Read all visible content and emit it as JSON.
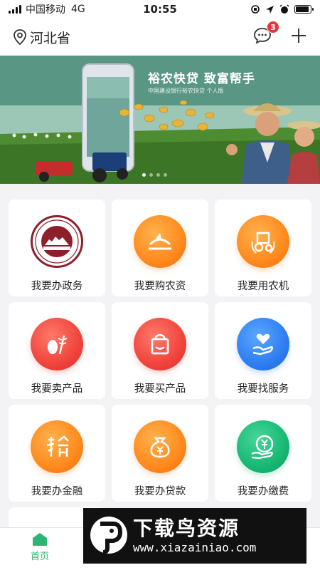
{
  "status_bar": {
    "carrier": "中国移动",
    "network": "4G",
    "time": "10:55",
    "battery_level": 0.9
  },
  "header": {
    "location": "河北省",
    "message_badge": "3"
  },
  "banner": {
    "title": "裕农快贷 致富帮手",
    "subtitle": "中国建设银行裕农快贷 个人版",
    "dot_count": 4,
    "active_dot": 0
  },
  "services": [
    {
      "label": "我要办政务",
      "icon": "government-seal-icon",
      "color": "seal"
    },
    {
      "label": "我要购农资",
      "icon": "farm-supplies-icon",
      "color": "orange"
    },
    {
      "label": "我要用农机",
      "icon": "farm-machinery-icon",
      "color": "orange"
    },
    {
      "label": "我要卖产品",
      "icon": "wheat-icon",
      "color": "red"
    },
    {
      "label": "我要买产品",
      "icon": "shopping-bag-icon",
      "color": "red"
    },
    {
      "label": "我要找服务",
      "icon": "heart-hand-icon",
      "color": "blue"
    },
    {
      "label": "我要办金融",
      "icon": "yu-finance-icon",
      "color": "orange"
    },
    {
      "label": "我要办贷款",
      "icon": "money-bag-icon",
      "color": "orange"
    },
    {
      "label": "我要办缴费",
      "icon": "yuan-payment-icon",
      "color": "green"
    }
  ],
  "bottom_nav": {
    "home_label": "首页",
    "accent": "#2bb673"
  },
  "watermark": {
    "title": "下载鸟资源",
    "url": "www.xiazainiao.com"
  }
}
